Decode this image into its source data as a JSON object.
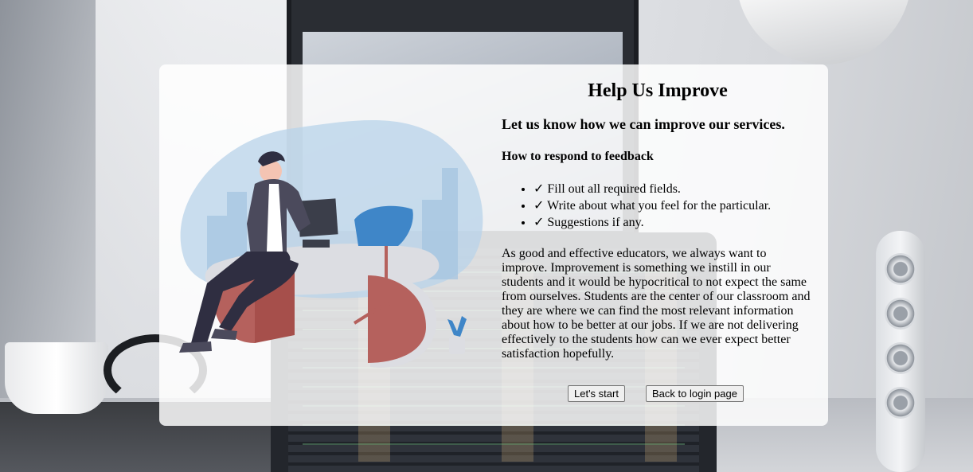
{
  "card": {
    "title": "Help Us Improve",
    "subtitle": "Let us know how we can improve our services.",
    "howto_heading": "How to respond to feedback",
    "steps": [
      "✓ Fill out all required fields.",
      "✓ Write about what you feel for the particular.",
      "✓ Suggestions if any."
    ],
    "paragraph": "As good and effective educators, we always want to improve. Improvement is something we instill in our students and it would be hypocritical to not expect the same from ourselves. Students are the center of our classroom and they are where we can find the most relevant information about how to be better at our jobs. If we are not delivering effectively to the students how can we ever expect better satisfaction hopefully."
  },
  "buttons": {
    "start_label": "Let's start",
    "login_label": "Back to login page"
  },
  "colors": {
    "card_background": "#ffffff",
    "illustration_blob": "#b8d3ea",
    "desk_accent": "#b5615d",
    "chair_accent": "#3f86c8"
  }
}
